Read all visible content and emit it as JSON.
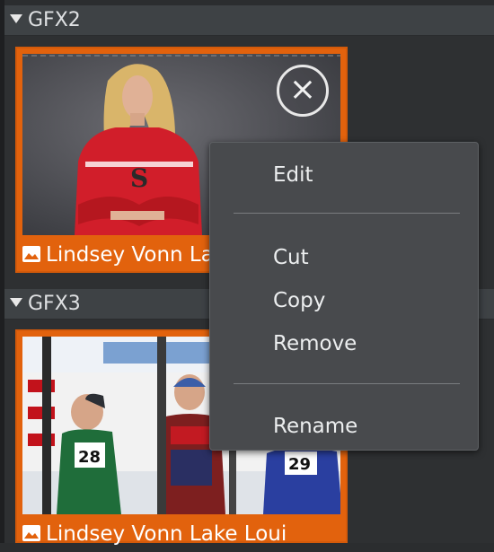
{
  "sections": [
    {
      "label": "GFX2"
    },
    {
      "label": "GFX3"
    }
  ],
  "items": [
    {
      "caption": "Lindsey Vonn Lake Louise"
    },
    {
      "caption": "Lindsey Vonn Lake Loui"
    }
  ],
  "close_glyph": "×",
  "context_menu": {
    "edit": "Edit",
    "cut": "Cut",
    "copy": "Copy",
    "remove": "Remove",
    "rename": "Rename"
  },
  "icons": {
    "collapse": "triangle-down-icon",
    "image": "image-icon",
    "close": "close-icon"
  },
  "colors": {
    "accent_orange": "#e2620d",
    "header_bg": "#3e4245",
    "menu_bg": "#484a4d"
  }
}
